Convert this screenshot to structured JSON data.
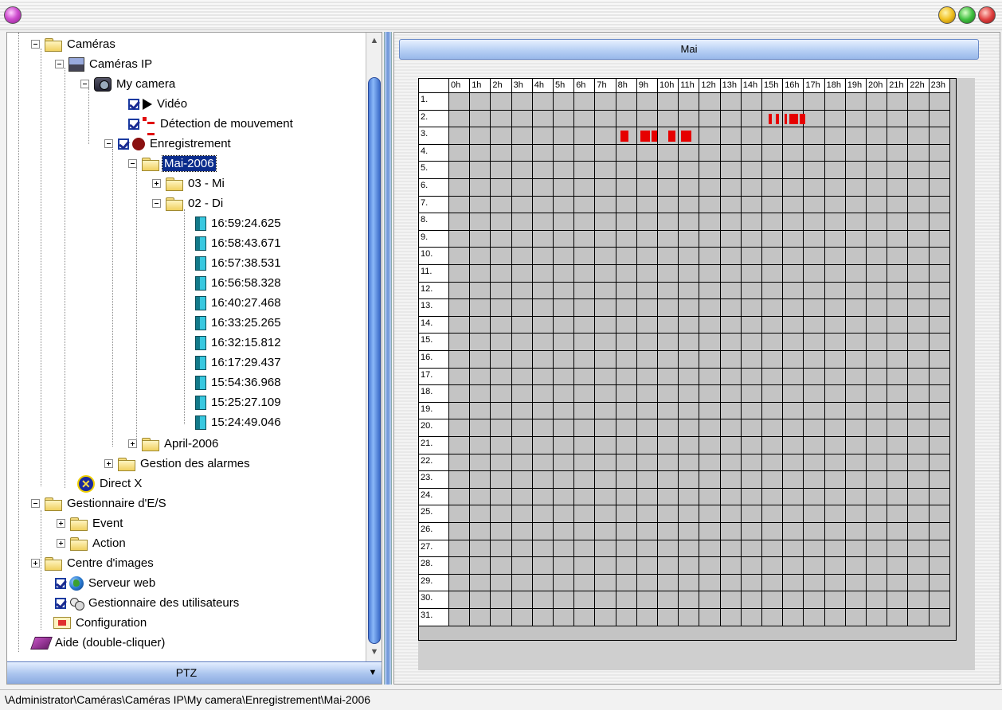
{
  "tree": {
    "cameras": "Caméras",
    "cameras_ip": "Caméras IP",
    "my_camera": "My camera",
    "video": "Vidéo",
    "motion_detection": "Détection de mouvement",
    "recording": "Enregistrement",
    "mai_2006": "Mai-2006",
    "day_03": "03 - Mi",
    "day_02": "02 - Di",
    "recordings": [
      "16:59:24.625",
      "16:58:43.671",
      "16:57:38.531",
      "16:56:58.328",
      "16:40:27.468",
      "16:33:25.265",
      "16:32:15.812",
      "16:17:29.437",
      "15:54:36.968",
      "15:25:27.109",
      "15:24:49.046"
    ],
    "april_2006": "April-2006",
    "alarm_management": "Gestion des alarmes",
    "direct_x": "Direct X",
    "io_manager": "Gestionnaire d'E/S",
    "event": "Event",
    "action": "Action",
    "image_center": "Centre d'images",
    "web_server": "Serveur web",
    "user_manager": "Gestionnaire des utilisateurs",
    "configuration": "Configuration",
    "help": "Aide (double-cliquer)"
  },
  "ptz": {
    "label": "PTZ"
  },
  "calendar": {
    "month_label": "Mai",
    "hours": [
      "0h",
      "1h",
      "2h",
      "3h",
      "4h",
      "5h",
      "6h",
      "7h",
      "8h",
      "9h",
      "10h",
      "11h",
      "12h",
      "13h",
      "14h",
      "15h",
      "16h",
      "17h",
      "18h",
      "19h",
      "20h",
      "21h",
      "22h",
      "23h"
    ],
    "days": [
      "1.",
      "2.",
      "3.",
      "4.",
      "5.",
      "6.",
      "7.",
      "8.",
      "9.",
      "10.",
      "11.",
      "12.",
      "13.",
      "14.",
      "15.",
      "16.",
      "17.",
      "18.",
      "19.",
      "20.",
      "21.",
      "22.",
      "23.",
      "24.",
      "25.",
      "26.",
      "27.",
      "28.",
      "29.",
      "30.",
      "31."
    ],
    "recordings": [
      {
        "day": 2,
        "start": 15.3,
        "end": 15.45
      },
      {
        "day": 2,
        "start": 15.65,
        "end": 15.8
      },
      {
        "day": 2,
        "start": 16.05,
        "end": 16.2
      },
      {
        "day": 2,
        "start": 16.3,
        "end": 16.7
      },
      {
        "day": 2,
        "start": 16.8,
        "end": 17.05
      },
      {
        "day": 3,
        "start": 8.2,
        "end": 8.6
      },
      {
        "day": 3,
        "start": 9.15,
        "end": 9.6
      },
      {
        "day": 3,
        "start": 9.7,
        "end": 9.95
      },
      {
        "day": 3,
        "start": 10.5,
        "end": 10.85
      },
      {
        "day": 3,
        "start": 11.1,
        "end": 11.6
      }
    ],
    "record_color": "#e60000"
  },
  "status": {
    "path": "\\Administrator\\Caméras\\Caméras IP\\My camera\\Enregistrement\\Mai-2006"
  }
}
